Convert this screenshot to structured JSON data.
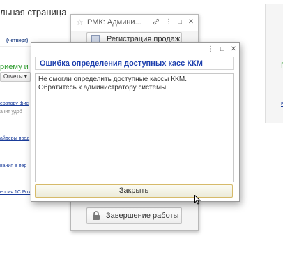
{
  "background": {
    "page_title": "льная страница",
    "weekday": "(четверг)",
    "left_green_link": "риему и о",
    "reports_dropdown": "Отчеты",
    "links": [
      "ератору фис",
      "айдеры прод",
      "вания в пер",
      "ерсия 1С:Роз"
    ],
    "note": "ачит удоб",
    "right_green_text": "Г",
    "right_link": "Б"
  },
  "rmk_window": {
    "title": "РМК: Админи...",
    "top_button_label": "Регистрация продаж",
    "bottom_button_label": "Завершение работы",
    "controls": {
      "link": "link-icon",
      "more": "more-icon",
      "maximize": "maximize-icon",
      "close": "close-icon"
    }
  },
  "error_dialog": {
    "heading": "Ошибка определения доступных касс ККМ",
    "message_line1": "Не смогли определить доступные кассы ККМ.",
    "message_line2": "Обратитесь к администратору системы.",
    "close_button_label": "Закрыть",
    "controls": {
      "more": "more-icon",
      "maximize": "maximize-icon",
      "close": "close-icon"
    },
    "colors": {
      "heading": "#1c3fae",
      "button_border": "#d6ba6a"
    }
  }
}
